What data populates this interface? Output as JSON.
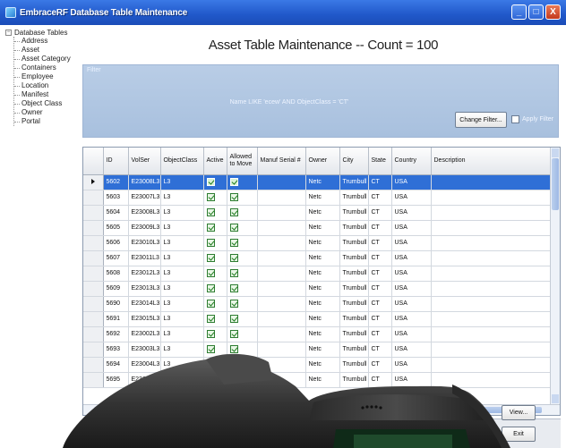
{
  "window": {
    "title": "EmbraceRF Database Table Maintenance",
    "buttons": {
      "minimize": "_",
      "maximize": "□",
      "close": "X"
    }
  },
  "sidebar": {
    "root_label": "Database Tables",
    "root_toggle": "−",
    "items": [
      "Address",
      "Asset",
      "Asset Category",
      "Containers",
      "Employee",
      "Location",
      "Manifest",
      "Object Class",
      "Owner",
      "Portal"
    ]
  },
  "main": {
    "heading": "Asset Table Maintenance -- Count = 100",
    "filter": {
      "label": "Filter",
      "text": "Name LIKE 'ecew' AND ObjectClass = 'CT'",
      "change_button": "Change Filter...",
      "apply_label": "Apply Filter"
    },
    "grid": {
      "columns": [
        "ID",
        "VolSer",
        "ObjectClass",
        "Active",
        "Allowed to Move",
        "Manuf Serial #",
        "Owner",
        "City",
        "State",
        "Country",
        "Description"
      ],
      "rows": [
        {
          "id": "5602",
          "volser": "E23008L3",
          "objclass": "L3",
          "owner": "Netc",
          "city": "Trumbull",
          "state": "CT",
          "country": "USA",
          "selected": true
        },
        {
          "id": "5603",
          "volser": "E23007L3",
          "objclass": "L3",
          "owner": "Netc",
          "city": "Trumbull",
          "state": "CT",
          "country": "USA"
        },
        {
          "id": "5604",
          "volser": "E23008L3",
          "objclass": "L3",
          "owner": "Netc",
          "city": "Trumbull",
          "state": "CT",
          "country": "USA"
        },
        {
          "id": "5605",
          "volser": "E23009L3",
          "objclass": "L3",
          "owner": "Netc",
          "city": "Trumbull",
          "state": "CT",
          "country": "USA"
        },
        {
          "id": "5606",
          "volser": "E23010L3",
          "objclass": "L3",
          "owner": "Netc",
          "city": "Trumbull",
          "state": "CT",
          "country": "USA"
        },
        {
          "id": "5607",
          "volser": "E23011L3",
          "objclass": "L3",
          "owner": "Netc",
          "city": "Trumbull",
          "state": "CT",
          "country": "USA"
        },
        {
          "id": "5608",
          "volser": "E23012L3",
          "objclass": "L3",
          "owner": "Netc",
          "city": "Trumbull",
          "state": "CT",
          "country": "USA"
        },
        {
          "id": "5609",
          "volser": "E23013L3",
          "objclass": "L3",
          "owner": "Netc",
          "city": "Trumbull",
          "state": "CT",
          "country": "USA"
        },
        {
          "id": "5690",
          "volser": "E23014L3",
          "objclass": "L3",
          "owner": "Netc",
          "city": "Trumbull",
          "state": "CT",
          "country": "USA"
        },
        {
          "id": "5691",
          "volser": "E23015L3",
          "objclass": "L3",
          "owner": "Netc",
          "city": "Trumbull",
          "state": "CT",
          "country": "USA"
        },
        {
          "id": "5692",
          "volser": "E23002L3",
          "objclass": "L3",
          "owner": "Netc",
          "city": "Trumbull",
          "state": "CT",
          "country": "USA"
        },
        {
          "id": "5693",
          "volser": "E23003L3",
          "objclass": "L3",
          "owner": "Netc",
          "city": "Trumbull",
          "state": "CT",
          "country": "USA"
        },
        {
          "id": "5694",
          "volser": "E23004L3",
          "objclass": "L3",
          "owner": "Netc",
          "city": "Trumbull",
          "state": "CT",
          "country": "USA"
        },
        {
          "id": "5695",
          "volser": "E23005L3",
          "objclass": "L3",
          "owner": "Netc",
          "city": "Trumbull",
          "state": "CT",
          "country": "USA"
        }
      ]
    },
    "buttons": {
      "view": "View...",
      "exit": "Exit"
    }
  },
  "colors": {
    "title_bar": "#2058c9",
    "selection": "#2f6fd6",
    "filter_panel": "#b0c6e2",
    "device_body": "#3a3a3a"
  }
}
